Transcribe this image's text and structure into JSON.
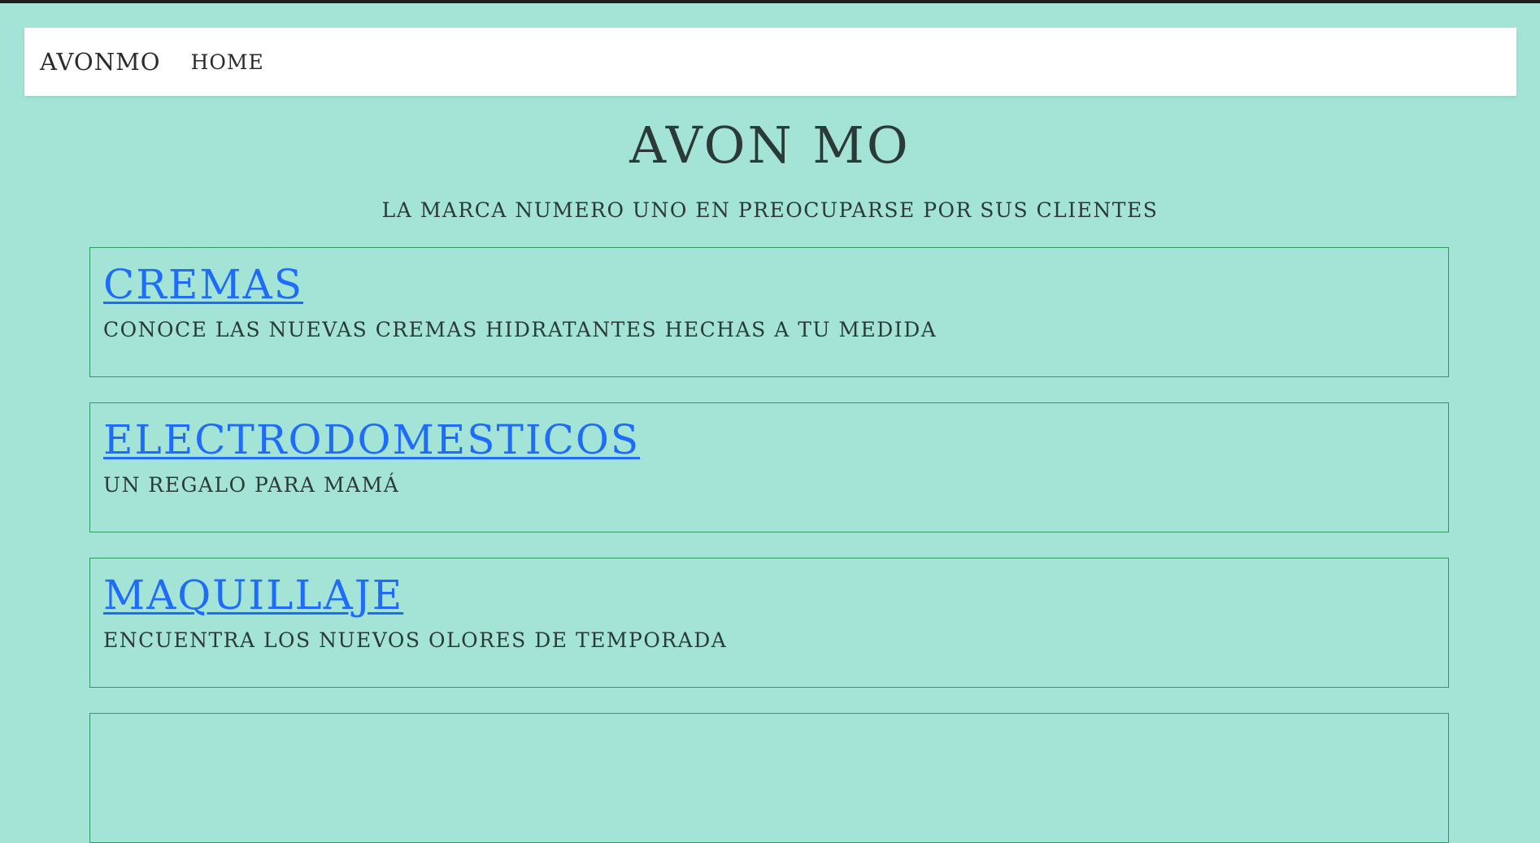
{
  "navbar": {
    "brand": "AVONMO",
    "links": [
      "HOME"
    ]
  },
  "hero": {
    "title": "AVON MO",
    "subtitle": "LA MARCA NUMERO UNO EN PREOCUPARSE POR SUS CLIENTES"
  },
  "cards": [
    {
      "title": "CREMAS",
      "description": "CONOCE LAS NUEVAS CREMAS HIDRATANTES HECHAS A TU MEDIDA"
    },
    {
      "title": "ELECTRODOMESTICOS",
      "description": "UN REGALO PARA MAMÁ"
    },
    {
      "title": "MAQUILLAJE",
      "description": "ENCUENTRA LOS NUEVOS OLORES DE TEMPORADA"
    }
  ],
  "colors": {
    "background": "#a3e4d7",
    "navbar": "#ffffff",
    "link": "#1e6bff",
    "card_border": "#2e9a5e",
    "text": "#2b3a36"
  }
}
